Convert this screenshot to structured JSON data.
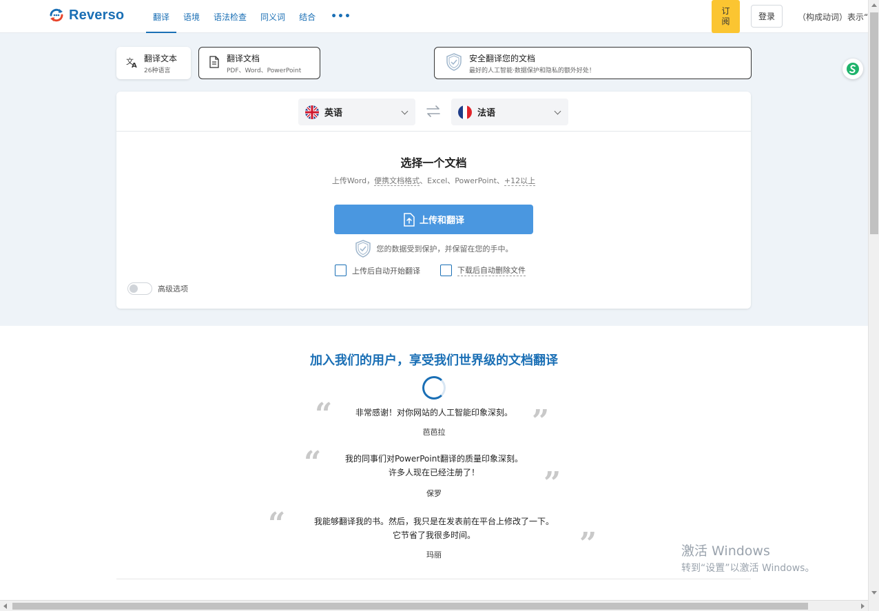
{
  "brand": {
    "name": "Reverso",
    "logo_icon": "reverso-logo-icon"
  },
  "nav": {
    "items": [
      {
        "label": "翻译",
        "active": true
      },
      {
        "label": "语境",
        "active": false
      },
      {
        "label": "语法检查",
        "active": false
      },
      {
        "label": "同义词",
        "active": false
      },
      {
        "label": "结合",
        "active": false
      }
    ],
    "more": "•••"
  },
  "header": {
    "subscribe_line1": "订",
    "subscribe_line2": "阅",
    "login": "登录",
    "hint": "（构成动词）表示“使"
  },
  "modes": {
    "text": {
      "title": "翻译文本",
      "sub": "26种语言"
    },
    "doc": {
      "title": "翻译文档",
      "sub": "PDF、Word、PowerPoint"
    },
    "secure": {
      "title": "安全翻译您的文档",
      "sub": "最好的人工智能·数据保护和隐私的额外好处！"
    }
  },
  "languages": {
    "source": "英语",
    "target": "法语"
  },
  "document": {
    "title": "选择一个文档",
    "formats_prefix": "上传Word，",
    "formats_portable": "便携文档格式",
    "formats_mid": "、Excel、PowerPoint、",
    "formats_more": "+12以上",
    "upload_button": "上传和翻译",
    "protection": "您的数据受到保护，并保留在您的手中。",
    "auto_translate": "上传后自动开始翻译",
    "auto_delete": "下载后自动删除文件",
    "advanced": "高级选项"
  },
  "testimonials": {
    "title": "加入我们的用户，享受我们世界级的文档翻译",
    "items": [
      {
        "line1": "非常感谢！对你网站的人工智能印象深刻。",
        "line2": "",
        "author": "芭芭拉"
      },
      {
        "line1": "我的同事们对PowerPoint翻译的质量印象深刻。",
        "line2": "许多人现在已经注册了！",
        "author": "保罗"
      },
      {
        "line1": "我能够翻译我的书。然后，我只是在发表前在平台上修改了一下。",
        "line2": "它节省了我很多时间。",
        "author": "玛丽"
      }
    ]
  },
  "watermark": {
    "line1": "激活 Windows",
    "line2": "转到“设置”以激活 Windows。"
  },
  "colors": {
    "brand_blue": "#1a6fb5",
    "button_blue": "#4a97e0",
    "subscribe_yellow": "#fbc531",
    "band_bg": "#eef3f8"
  }
}
